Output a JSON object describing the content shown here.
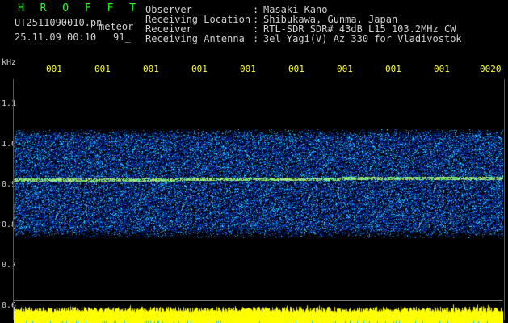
{
  "header": {
    "brand": "H R O F F T",
    "filename": "UT2511090010.pn",
    "event_type": "meteor",
    "datetime": "25.11.09 00:10",
    "frame_number": "91_",
    "fields": [
      {
        "key": "Observer",
        "value": "Masaki Kano"
      },
      {
        "key": "Receiving Location",
        "value": "Shibukawa, Gunma, Japan"
      },
      {
        "key": "Receiver",
        "value": "RTL-SDR SDR# 43dB L15 103.2MHz CW"
      },
      {
        "key": "Receiving Antenna",
        "value": "3el Yagi(V) Az 330 for Vladivostok"
      }
    ]
  },
  "axis": {
    "unit": "kHz",
    "y_ticks": [
      "1.1",
      "1.0",
      "0.9",
      "0.8",
      "0.7",
      "0.6"
    ],
    "time_ticks": [
      "001",
      "001",
      "001",
      "001",
      "001",
      "001",
      "001",
      "001",
      "001",
      "0020"
    ]
  },
  "colors": {
    "brand": "#22ff22",
    "text": "#d0d0d0",
    "time_tick": "#ffff33",
    "signal": "#ffff00",
    "noise_low": "#0a1a90",
    "noise_high": "#3aa0ff"
  }
}
